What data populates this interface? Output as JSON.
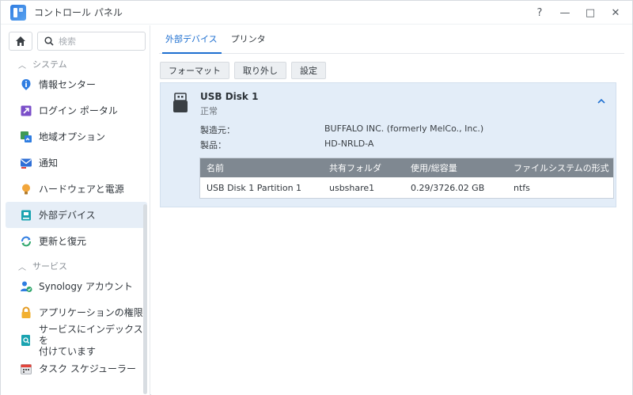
{
  "window": {
    "title": "コントロール パネル",
    "controls": {
      "help": "?",
      "minimize": "—",
      "maximize": "□",
      "close": "✕"
    }
  },
  "sidebar": {
    "search_placeholder": "検索",
    "sections": [
      {
        "label": "システム",
        "items": [
          {
            "label": "情報センター",
            "icon": "info-icon"
          },
          {
            "label": "ログイン ポータル",
            "icon": "login-portal-icon"
          },
          {
            "label": "地域オプション",
            "icon": "regional-options-icon"
          },
          {
            "label": "通知",
            "icon": "notification-icon"
          },
          {
            "label": "ハードウェアと電源",
            "icon": "hardware-power-icon"
          },
          {
            "label": "外部デバイス",
            "icon": "external-device-icon",
            "active": true
          },
          {
            "label": "更新と復元",
            "icon": "update-restore-icon"
          }
        ]
      },
      {
        "label": "サービス",
        "items": [
          {
            "label": "Synology アカウント",
            "icon": "synology-account-icon"
          },
          {
            "label": "アプリケーションの権限",
            "icon": "lock-icon"
          },
          {
            "label_line1": "サービスにインデックスを",
            "label_line2": "付けています",
            "icon": "indexing-service-icon"
          },
          {
            "label": "タスク スケジューラー",
            "icon": "calendar-icon"
          }
        ]
      }
    ]
  },
  "main": {
    "tabs": [
      {
        "label": "外部デバイス",
        "active": true
      },
      {
        "label": "プリンタ"
      }
    ],
    "toolbar": {
      "format": "フォーマット",
      "eject": "取り外し",
      "settings": "設定"
    },
    "device": {
      "name": "USB Disk 1",
      "status": "正常",
      "manufacturer_label": "製造元：",
      "manufacturer": "BUFFALO INC. (formerly MelCo., Inc.)",
      "product_label": "製品：",
      "product": "HD-NRLD-A",
      "table": {
        "headers": [
          "名前",
          "共有フォルダ",
          "使用/総容量",
          "ファイルシステムの形式"
        ],
        "rows": [
          [
            "USB Disk 1 Partition 1",
            "usbshare1",
            "0.29/3726.02 GB",
            "ntfs"
          ]
        ]
      }
    }
  },
  "colors": {
    "accent": "#1e6fd0",
    "active_nav_bg": "#e6eef7",
    "device_panel_bg": "#e3edf8",
    "table_header_bg": "#7f8891"
  }
}
